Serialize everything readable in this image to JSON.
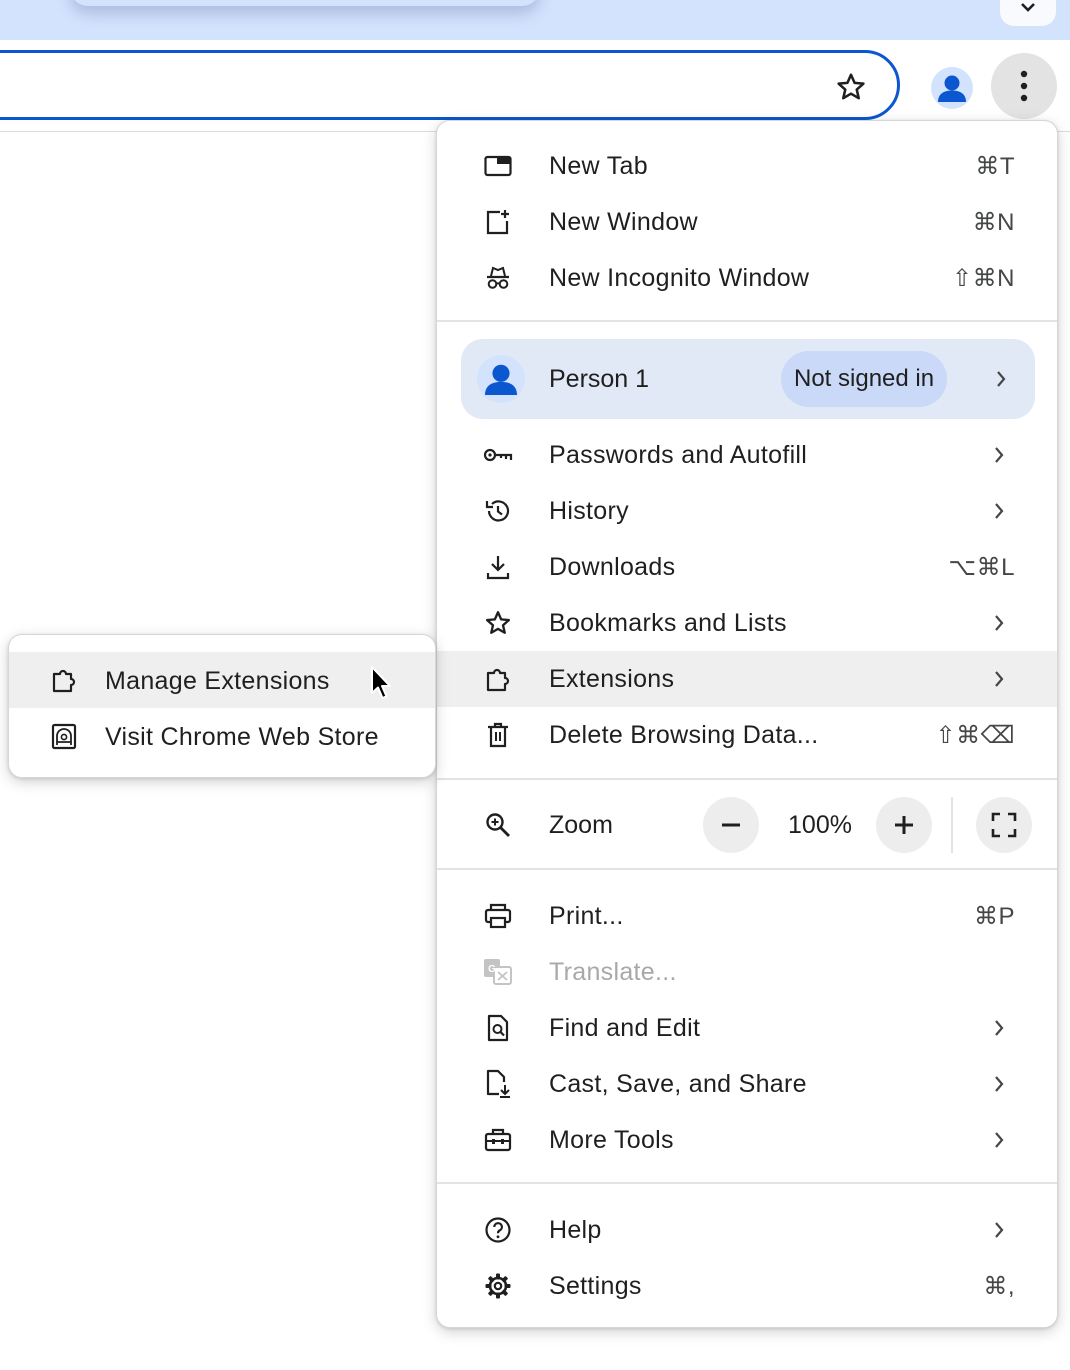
{
  "browser": {
    "toolbar": {
      "bookmark_star": "star-icon",
      "profile_avatar": "person-icon",
      "menu_button": "more-vert-icon"
    }
  },
  "menu": {
    "items_group1": [
      {
        "label": "New Tab",
        "shortcut": "⌘T",
        "icon": "new-tab-icon"
      },
      {
        "label": "New Window",
        "shortcut": "⌘N",
        "icon": "new-window-icon"
      },
      {
        "label": "New Incognito Window",
        "shortcut": "⇧⌘N",
        "icon": "incognito-icon"
      }
    ],
    "profile": {
      "name": "Person 1",
      "status": "Not signed in"
    },
    "items_group2": [
      {
        "label": "Passwords and Autofill",
        "shortcut": "",
        "icon": "key-icon",
        "submenu": true
      },
      {
        "label": "History",
        "shortcut": "",
        "icon": "history-icon",
        "submenu": true
      },
      {
        "label": "Downloads",
        "shortcut": "⌥⌘L",
        "icon": "download-icon",
        "submenu": false
      },
      {
        "label": "Bookmarks and Lists",
        "shortcut": "",
        "icon": "star-icon",
        "submenu": true
      },
      {
        "label": "Extensions",
        "shortcut": "",
        "icon": "puzzle-icon",
        "submenu": true
      },
      {
        "label": "Delete Browsing Data...",
        "shortcut": "⇧⌘⌫",
        "icon": "trash-icon",
        "submenu": false
      }
    ],
    "zoom": {
      "label": "Zoom",
      "value": "100%",
      "minus": "−",
      "plus": "+"
    },
    "items_group3": [
      {
        "label": "Print...",
        "shortcut": "⌘P",
        "icon": "print-icon",
        "submenu": false,
        "disabled": false
      },
      {
        "label": "Translate...",
        "shortcut": "",
        "icon": "translate-icon",
        "submenu": false,
        "disabled": true
      },
      {
        "label": "Find and Edit",
        "shortcut": "",
        "icon": "find-in-page-icon",
        "submenu": true,
        "disabled": false
      },
      {
        "label": "Cast, Save, and Share",
        "shortcut": "",
        "icon": "save-share-icon",
        "submenu": true,
        "disabled": false
      },
      {
        "label": "More Tools",
        "shortcut": "",
        "icon": "toolbox-icon",
        "submenu": true,
        "disabled": false
      }
    ],
    "items_group4": [
      {
        "label": "Help",
        "shortcut": "",
        "icon": "help-icon",
        "submenu": true
      },
      {
        "label": "Settings",
        "shortcut": "⌘,",
        "icon": "settings-icon",
        "submenu": false
      }
    ]
  },
  "extensions_submenu": {
    "items": [
      {
        "label": "Manage Extensions",
        "icon": "puzzle-icon"
      },
      {
        "label": "Visit Chrome Web Store",
        "icon": "web-store-icon"
      }
    ]
  },
  "colors": {
    "accent": "#0b57d0",
    "tabstrip": "#d3e3fd",
    "profile_bg": "#e1e9f7",
    "hover_bg": "#efefef"
  }
}
